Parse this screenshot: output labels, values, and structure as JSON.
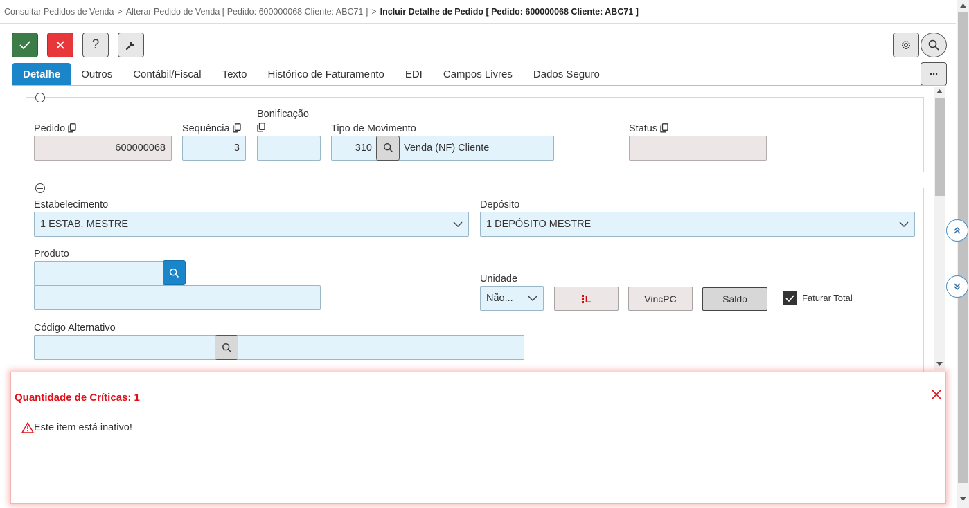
{
  "breadcrumb": {
    "item1": "Consultar Pedidos de Venda",
    "item2": "Alterar Pedido de Venda [ Pedido: 600000068 Cliente: ABC71 ]",
    "item3": "Incluir Detalhe de Pedido [ Pedido: 600000068 Cliente: ABC71 ]",
    "separator": ">"
  },
  "toolbar": {
    "help_label": "?",
    "more_label": "···"
  },
  "tabs": [
    "Detalhe",
    "Outros",
    "Contábil/Fiscal",
    "Texto",
    "Histórico de Faturamento",
    "EDI",
    "Campos Livres",
    "Dados Seguro"
  ],
  "section1": {
    "pedido": {
      "label": "Pedido",
      "value": "600000068"
    },
    "sequencia": {
      "label": "Sequência",
      "value": "3"
    },
    "bonificacao": {
      "label": "Bonificação",
      "value": ""
    },
    "tipo_movimento": {
      "label": "Tipo de Movimento",
      "code": "310",
      "description": "Venda (NF) Cliente"
    },
    "status": {
      "label": "Status",
      "value": ""
    }
  },
  "section2": {
    "estabelecimento": {
      "label": "Estabelecimento",
      "value": "1 ESTAB. MESTRE"
    },
    "deposito": {
      "label": "Depósito",
      "value": "1 DEPÓSITO MESTRE"
    },
    "produto": {
      "label": "Produto",
      "code": "",
      "description": ""
    },
    "unidade": {
      "label": "Unidade",
      "value": "Não..."
    },
    "buttons": {
      "il_label": "L",
      "vincpc_label": "VincPC",
      "saldo_label": "Saldo"
    },
    "faturar_total": {
      "label": "Faturar Total",
      "checked": true
    },
    "codigo_alternativo": {
      "label": "Código Alternativo",
      "code": "",
      "description": ""
    }
  },
  "criticas": {
    "title": "Quantidade de Críticas: 1",
    "message": "Este item está inativo!"
  },
  "colors": {
    "accent": "#1a85c9",
    "confirm": "#3c7d47",
    "cancel": "#e8373b",
    "error": "#e0101a",
    "field_bg": "#e3f3fc"
  }
}
